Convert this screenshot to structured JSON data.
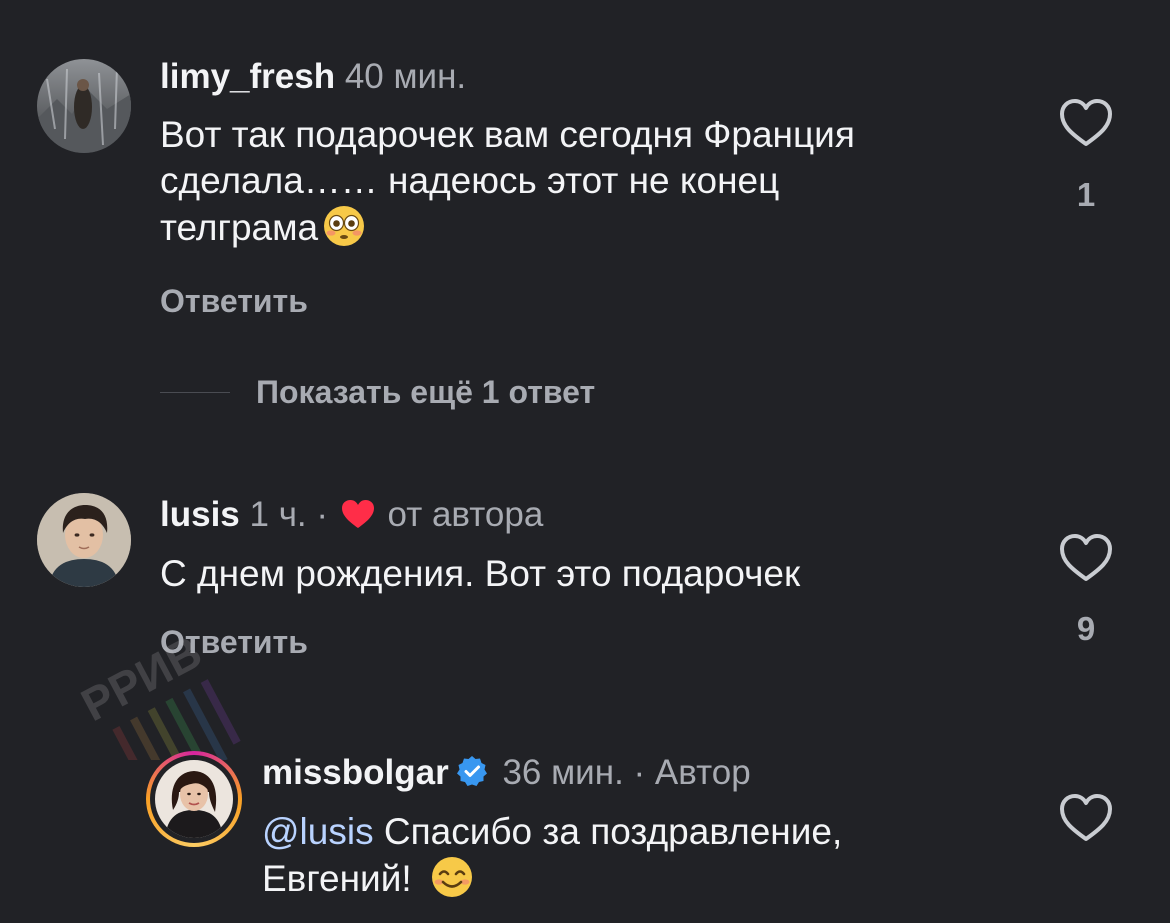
{
  "comments": [
    {
      "username": "limy_fresh",
      "time": "40 мин.",
      "text_lines": [
        "Вот так подарочек вам сегодня Франция",
        "сделала…… надеюсь этот не конец",
        "телграма"
      ],
      "emoji": "flushed-face",
      "reply_label": "Ответить",
      "likes": "1"
    },
    {
      "username": "lusis",
      "time": "1 ч.",
      "separator": "·",
      "byline": "от автора",
      "text_lines": [
        "С днем рождения. Вот это подарочек"
      ],
      "reply_label": "Ответить",
      "likes": "9"
    }
  ],
  "show_more": {
    "label": "Показать ещё 1 ответ"
  },
  "reply_comment": {
    "username": "missbolgar",
    "time": "36 мин.",
    "separator": "·",
    "byline": "Автор",
    "mention": "@lusis",
    "text_line1_rest": " Спасибо за поздравление,",
    "text_line2": "Евгений! ",
    "emoji": "smiling-face"
  },
  "watermark": {
    "text": "PPИВ"
  },
  "colors": {
    "background": "#212226",
    "primary_text": "#f3f4f6",
    "secondary_text": "#a8abb2",
    "mention": "#b9d3ff",
    "creator_heart": "#ff2d48",
    "verified": "#3897f0",
    "story_ring_start": "#f9a025",
    "story_ring_end": "#d6249f"
  }
}
